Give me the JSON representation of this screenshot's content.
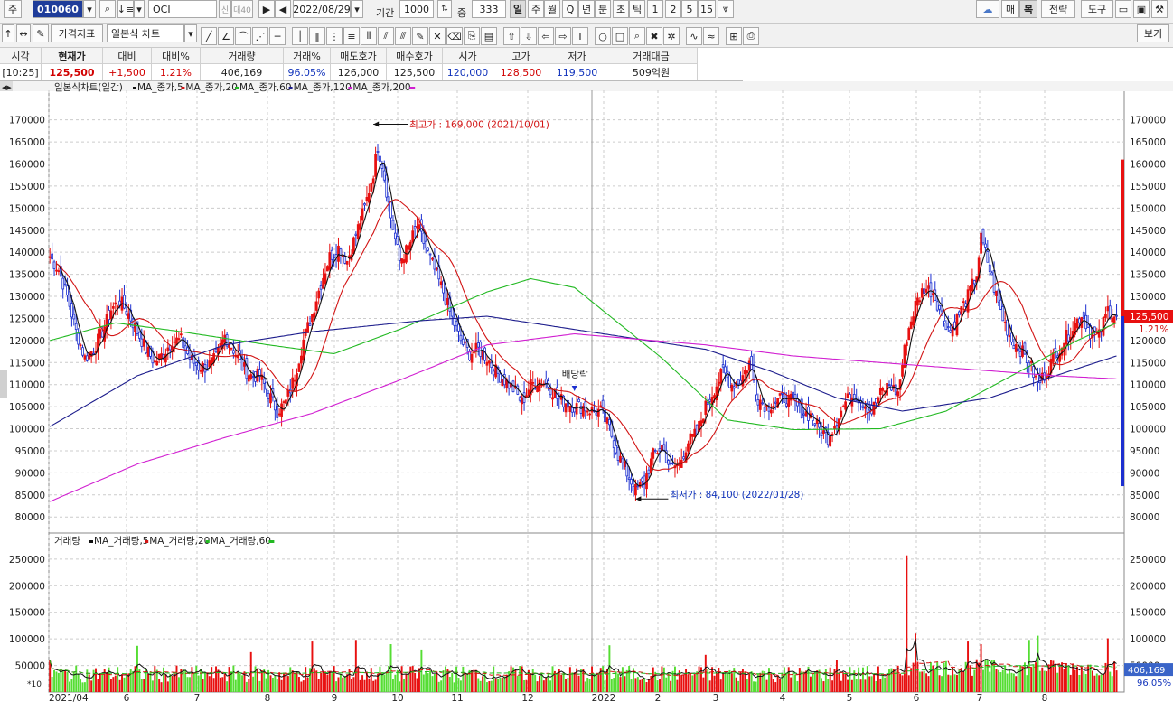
{
  "toolbar": {
    "prefix": "주",
    "stock_code": "010060",
    "stock_name": "OCI",
    "credit_badge": "신",
    "margin_badge": "대40",
    "date": "2022/08/29",
    "period_label": "기간",
    "period_value": "1000",
    "count_label": "중",
    "count_value": "333",
    "periods": [
      "일",
      "주",
      "월",
      "Q",
      "년",
      "분",
      "초",
      "틱",
      "1",
      "2",
      "5",
      "15"
    ],
    "active_period": "일",
    "right_buttons": [
      "매",
      "복",
      "전략",
      "도구"
    ],
    "indicator_button": "가격지표",
    "chart_type_select": "일본식 차트",
    "view_button": "보기"
  },
  "quote": {
    "headers": [
      "시각",
      "현재가",
      "대비",
      "대비%",
      "거래량",
      "거래%",
      "매도호가",
      "매수호가",
      "시가",
      "고가",
      "저가",
      "거래대금"
    ],
    "values": [
      "[10:25]",
      "125,500",
      "+1,500",
      "1.21%",
      "406,169",
      "96.05%",
      "126,000",
      "125,500",
      "120,000",
      "128,500",
      "119,500",
      "509억원"
    ]
  },
  "price_panel": {
    "title": "일본식차트(일간)",
    "ma_legend": [
      {
        "label": "MA_종가,5",
        "color": "#111111"
      },
      {
        "label": "MA_종가,20",
        "color": "#d21414"
      },
      {
        "label": "MA_종가,60",
        "color": "#22b922"
      },
      {
        "label": "MA_종가,120",
        "color": "#1c1c8c"
      },
      {
        "label": "MA_종가,200",
        "color": "#d11fd1"
      }
    ],
    "high_annotation": "최고가 : 169,000 (2021/10/01)",
    "low_annotation": "최저가 : 84,100 (2022/01/28)",
    "dividend_label": "배당락",
    "current_price_tag": "125,500",
    "current_change_tag": "1.21%"
  },
  "volume_panel": {
    "title": "거래량",
    "ma_legend": [
      {
        "label": "MA_거래량,5",
        "color": "#111111"
      },
      {
        "label": "MA_거래량,20",
        "color": "#d21414"
      },
      {
        "label": "MA_거래량,60",
        "color": "#22b922"
      }
    ],
    "unit_label": "*10",
    "current_volume_tag": "406,169",
    "current_volume_pct": "96.05%"
  },
  "chart_data": [
    {
      "type": "candlestick",
      "title": "일본식차트(일간)",
      "ylim": [
        78000,
        173000
      ],
      "y_ticks": [
        80000,
        85000,
        90000,
        95000,
        100000,
        105000,
        110000,
        115000,
        120000,
        125000,
        130000,
        135000,
        140000,
        145000,
        150000,
        155000,
        160000,
        165000,
        170000
      ],
      "x_tick_labels": [
        "2021/04",
        "6",
        "7",
        "8",
        "9",
        "10",
        "11",
        "12",
        "2022",
        "2",
        "3",
        "4",
        "5",
        "6",
        "7",
        "8"
      ],
      "closing_price_path": [
        [
          0,
          139000
        ],
        [
          4,
          136000
        ],
        [
          8,
          130000
        ],
        [
          12,
          122000
        ],
        [
          16,
          116000
        ],
        [
          20,
          118000
        ],
        [
          24,
          122000
        ],
        [
          28,
          127000
        ],
        [
          32,
          129000
        ],
        [
          36,
          126000
        ],
        [
          40,
          122000
        ],
        [
          44,
          118000
        ],
        [
          48,
          115000
        ],
        [
          52,
          117000
        ],
        [
          56,
          120000
        ],
        [
          60,
          120000
        ],
        [
          64,
          116000
        ],
        [
          68,
          114000
        ],
        [
          72,
          114000
        ],
        [
          76,
          116000
        ],
        [
          80,
          121000
        ],
        [
          84,
          118000
        ],
        [
          88,
          114000
        ],
        [
          92,
          112000
        ],
        [
          96,
          112000
        ],
        [
          100,
          108000
        ],
        [
          104,
          104000
        ],
        [
          108,
          106000
        ],
        [
          112,
          112000
        ],
        [
          116,
          120000
        ],
        [
          120,
          126000
        ],
        [
          124,
          133000
        ],
        [
          128,
          139000
        ],
        [
          132,
          141000
        ],
        [
          136,
          138000
        ],
        [
          140,
          144000
        ],
        [
          144,
          150000
        ],
        [
          148,
          158000
        ],
        [
          150,
          164000
        ],
        [
          152,
          160000
        ],
        [
          156,
          148000
        ],
        [
          160,
          138000
        ],
        [
          164,
          141000
        ],
        [
          168,
          146000
        ],
        [
          172,
          141000
        ],
        [
          176,
          136000
        ],
        [
          180,
          131000
        ],
        [
          184,
          125000
        ],
        [
          188,
          120000
        ],
        [
          192,
          117000
        ],
        [
          196,
          118000
        ],
        [
          200,
          116000
        ],
        [
          204,
          113000
        ],
        [
          208,
          111000
        ],
        [
          212,
          109000
        ],
        [
          216,
          106000
        ],
        [
          220,
          110000
        ],
        [
          224,
          111000
        ],
        [
          228,
          110000
        ],
        [
          232,
          107000
        ],
        [
          236,
          106000
        ],
        [
          240,
          105000
        ],
        [
          244,
          105000
        ],
        [
          248,
          104000
        ],
        [
          252,
          104000
        ],
        [
          256,
          100000
        ],
        [
          260,
          94000
        ],
        [
          264,
          90000
        ],
        [
          268,
          86000
        ],
        [
          272,
          88000
        ],
        [
          276,
          94000
        ],
        [
          280,
          96000
        ],
        [
          284,
          91000
        ],
        [
          288,
          92000
        ],
        [
          292,
          97000
        ],
        [
          296,
          99000
        ],
        [
          300,
          105000
        ],
        [
          304,
          109000
        ],
        [
          308,
          113000
        ],
        [
          312,
          110000
        ],
        [
          316,
          111000
        ],
        [
          320,
          115000
        ],
        [
          324,
          107000
        ],
        [
          328,
          105000
        ],
        [
          332,
          106000
        ],
        [
          336,
          107000
        ],
        [
          340,
          106000
        ],
        [
          344,
          104000
        ],
        [
          348,
          103000
        ],
        [
          352,
          100000
        ],
        [
          356,
          98000
        ],
        [
          360,
          102000
        ],
        [
          364,
          106000
        ],
        [
          368,
          108000
        ],
        [
          372,
          106000
        ],
        [
          376,
          104000
        ],
        [
          380,
          108000
        ],
        [
          384,
          110000
        ],
        [
          388,
          108000
        ],
        [
          392,
          121000
        ],
        [
          396,
          128000
        ],
        [
          400,
          132000
        ],
        [
          404,
          131000
        ],
        [
          408,
          126000
        ],
        [
          412,
          122000
        ],
        [
          416,
          126000
        ],
        [
          420,
          130000
        ],
        [
          424,
          135000
        ],
        [
          426,
          143000
        ],
        [
          428,
          140000
        ],
        [
          432,
          132000
        ],
        [
          436,
          125000
        ],
        [
          440,
          120000
        ],
        [
          444,
          118000
        ],
        [
          448,
          115000
        ],
        [
          452,
          110000
        ],
        [
          456,
          113000
        ],
        [
          460,
          117000
        ],
        [
          464,
          120000
        ],
        [
          468,
          123000
        ],
        [
          472,
          126000
        ],
        [
          476,
          122000
        ],
        [
          480,
          121000
        ],
        [
          484,
          127000
        ],
        [
          488,
          125500
        ]
      ]
    },
    {
      "type": "bar",
      "title": "거래량",
      "ylim": [
        0,
        265000
      ],
      "y_ticks": [
        50000,
        100000,
        150000,
        200000,
        250000
      ],
      "spikes": [
        {
          "x": 0,
          "value": 60000
        },
        {
          "x": 40,
          "value": 87000
        },
        {
          "x": 92,
          "value": 75000
        },
        {
          "x": 120,
          "value": 95000
        },
        {
          "x": 140,
          "value": 98000
        },
        {
          "x": 156,
          "value": 90000
        },
        {
          "x": 170,
          "value": 80000
        },
        {
          "x": 256,
          "value": 88000
        },
        {
          "x": 300,
          "value": 70000
        },
        {
          "x": 360,
          "value": 60000
        },
        {
          "x": 392,
          "value": 257000
        },
        {
          "x": 396,
          "value": 110000
        },
        {
          "x": 420,
          "value": 95000
        },
        {
          "x": 426,
          "value": 90000
        },
        {
          "x": 448,
          "value": 98000
        },
        {
          "x": 452,
          "value": 106000
        },
        {
          "x": 484,
          "value": 101000
        },
        {
          "x": 488,
          "value": 40617
        }
      ]
    }
  ]
}
